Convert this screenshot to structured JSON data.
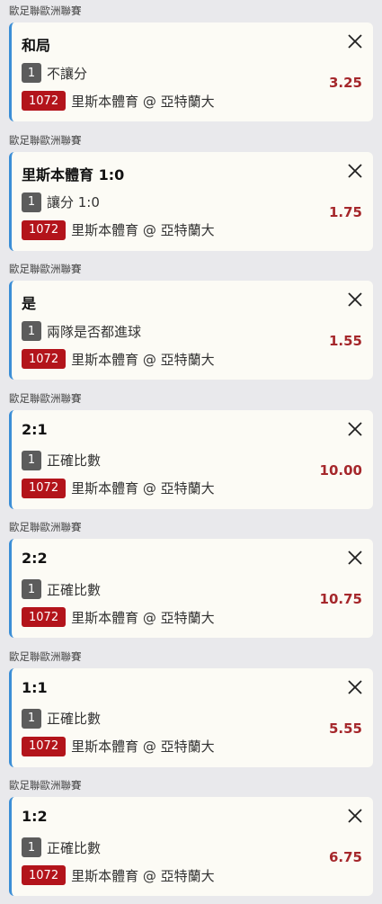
{
  "bets": [
    {
      "league": "歐足聯歐洲聯賽",
      "selection": "和局",
      "leg": "1",
      "market": "不讓分",
      "code": "1072",
      "event": "里斯本體育 @ 亞特蘭大",
      "odds": "3.25"
    },
    {
      "league": "歐足聯歐洲聯賽",
      "selection": "里斯本體育 1:0",
      "leg": "1",
      "market": "讓分 1:0",
      "code": "1072",
      "event": "里斯本體育 @ 亞特蘭大",
      "odds": "1.75"
    },
    {
      "league": "歐足聯歐洲聯賽",
      "selection": "是",
      "leg": "1",
      "market": "兩隊是否都進球",
      "code": "1072",
      "event": "里斯本體育 @ 亞特蘭大",
      "odds": "1.55"
    },
    {
      "league": "歐足聯歐洲聯賽",
      "selection": "2:1",
      "leg": "1",
      "market": "正確比數",
      "code": "1072",
      "event": "里斯本體育 @ 亞特蘭大",
      "odds": "10.00"
    },
    {
      "league": "歐足聯歐洲聯賽",
      "selection": "2:2",
      "leg": "1",
      "market": "正確比數",
      "code": "1072",
      "event": "里斯本體育 @ 亞特蘭大",
      "odds": "10.75"
    },
    {
      "league": "歐足聯歐洲聯賽",
      "selection": "1:1",
      "leg": "1",
      "market": "正確比數",
      "code": "1072",
      "event": "里斯本體育 @ 亞特蘭大",
      "odds": "5.55"
    },
    {
      "league": "歐足聯歐洲聯賽",
      "selection": "1:2",
      "leg": "1",
      "market": "正確比數",
      "code": "1072",
      "event": "里斯本體育 @ 亞特蘭大",
      "odds": "6.75"
    }
  ],
  "colors": {
    "accent": "#3b8ed6",
    "code_badge": "#b3141b",
    "odds": "#a5272b",
    "leg_badge": "#5c5c5c"
  },
  "icons": {
    "remove": "close-icon"
  }
}
